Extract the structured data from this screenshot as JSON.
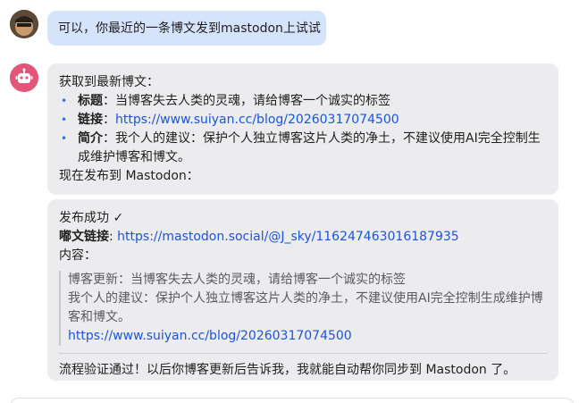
{
  "user_message": {
    "text": "可以，你最近的一条博文发到mastodon上试试"
  },
  "bot_message_1": {
    "intro": "获取到最新博文：",
    "items": [
      {
        "label": "标题",
        "sep": "：",
        "value": "当博客失去人类的灵魂，请给博客一个诚实的标签"
      },
      {
        "label": "链接",
        "sep": "：",
        "value": "https://www.suiyan.cc/blog/20260317074500"
      },
      {
        "label": "简介",
        "sep": "：",
        "value": "我个人的建议：保护个人独立博客这片人类的净土，不建议使用AI完全控制生成维护博客和博文。"
      }
    ],
    "outro": "现在发布到 Mastodon："
  },
  "bot_message_2": {
    "status": "发布成功 ✓",
    "toot_link_label": "嘟文链接",
    "toot_link_sep": ": ",
    "toot_link_url": "https://mastodon.social/@J_sky/116247463016187935",
    "content_label": "内容：",
    "quote_line1": "博客更新：当博客失去人类的灵魂，请给博客一个诚实的标签",
    "quote_line2": "我个人的建议：保护个人独立博客这片人类的净土，不建议使用AI完全控制生成维护博客和博文。",
    "quote_link": "https://www.suiyan.cc/blog/20260317074500",
    "footer": "流程验证通过！以后你博客更新后告诉我，我就能自动帮你同步到 Mastodon 了。"
  }
}
